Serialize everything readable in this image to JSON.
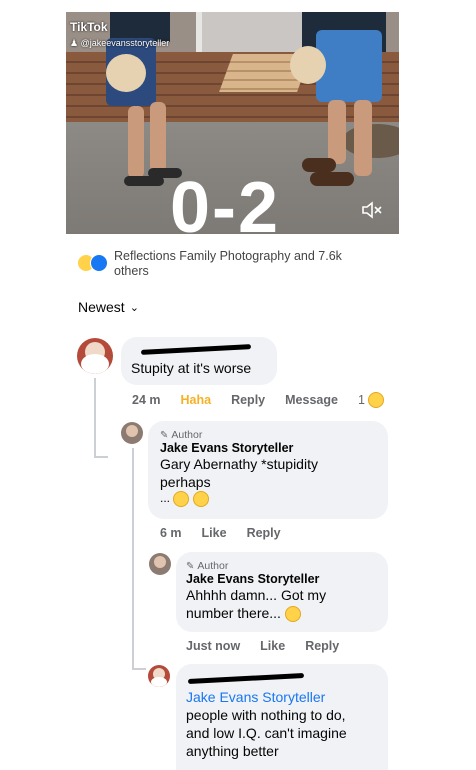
{
  "video": {
    "platform": "TikTok",
    "handle": "@jakeevansstoryteller",
    "score_overlay": "0-2",
    "mute_icon": "speaker-mute-icon"
  },
  "reactions": {
    "icons": [
      "haha-reaction-icon",
      "like-reaction-icon"
    ],
    "summary": "Reflections Family Photography and 7.6k others"
  },
  "sort": {
    "label": "Newest"
  },
  "comments": [
    {
      "text": "Stupity at it's worse",
      "time": "24 m",
      "reaction_label": "Haha",
      "reply_label": "Reply",
      "message_label": "Message",
      "reaction_count": "1"
    }
  ],
  "replies": [
    {
      "badge": "Author",
      "name": "Jake Evans Storyteller",
      "text_line1": "Gary Abernathy *stupidity",
      "text_line2": "perhaps",
      "text_line3": "...",
      "time": "6 m",
      "like_label": "Like",
      "reply_label": "Reply"
    },
    {
      "badge": "Author",
      "name": "Jake Evans Storyteller",
      "text_line1": "Ahhhh damn... Got my",
      "text_line2": "number there...",
      "time": "Just now",
      "like_label": "Like",
      "reply_label": "Reply"
    },
    {
      "mention": "Jake Evans Storyteller",
      "text_line1": "people with nothing to do,",
      "text_line2": "and low I.Q. can't imagine",
      "text_line3": "anything better"
    }
  ],
  "colors": {
    "haha": "#f7b125",
    "mention": "#1877f2",
    "bubble": "#f0f2f5",
    "meta": "#65676b"
  }
}
